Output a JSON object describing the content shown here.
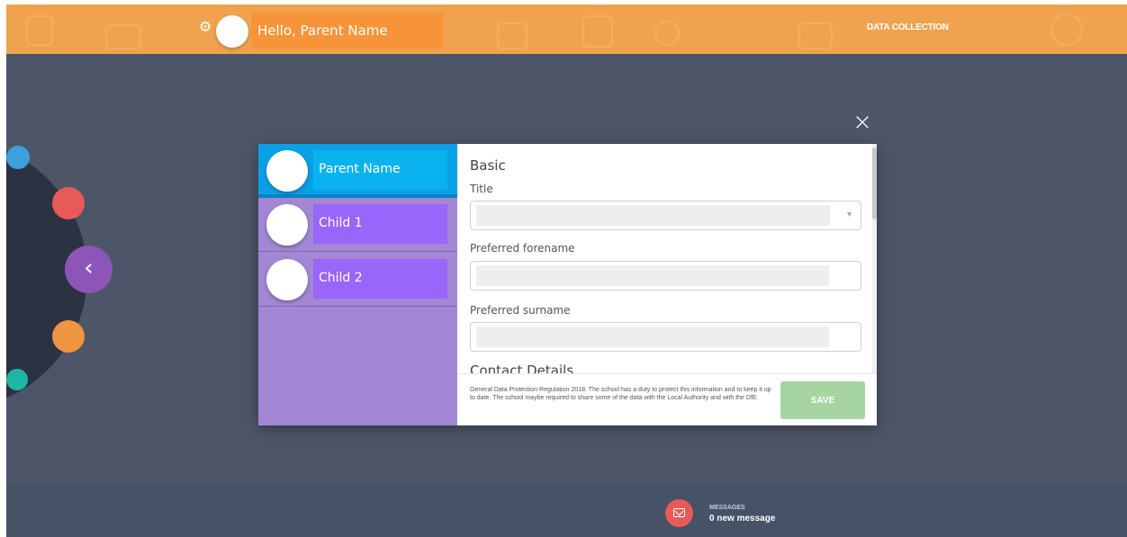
{
  "header": {
    "greeting": "Hello, Parent Name",
    "data_collection": "DATA COLLECTION",
    "gear_icon": "gear-icon"
  },
  "nav": {
    "back_icon": "chevron-left-icon",
    "back_glyph": "‹"
  },
  "modal": {
    "close_glyph": "×",
    "people": [
      {
        "name": "Parent Name",
        "selected": true
      },
      {
        "name": "Child 1",
        "selected": false
      },
      {
        "name": "Child 2",
        "selected": false
      }
    ],
    "sections": {
      "basic": "Basic",
      "contact": "Contact Details"
    },
    "fields": {
      "title_label": "Title",
      "title_value": "",
      "forename_label": "Preferred forename",
      "forename_value": "",
      "surname_label": "Preferred surname",
      "surname_value": ""
    },
    "gdpr_text": "General Data Protection Regulation 2018: The school has a duty to protect this information and to keep it up to date. The school maybe required to share some of the data with the Local Authority and with the DfE.",
    "save_label": "SAVE"
  },
  "messages": {
    "title": "MESSAGES",
    "count_text": "0 new message"
  },
  "colors": {
    "header_bg": "#f0a34e",
    "background": "#4d5669",
    "parent_tab": "#0aa0e6",
    "child_tab": "#9966fb",
    "save_button": "#a6d5a2"
  }
}
